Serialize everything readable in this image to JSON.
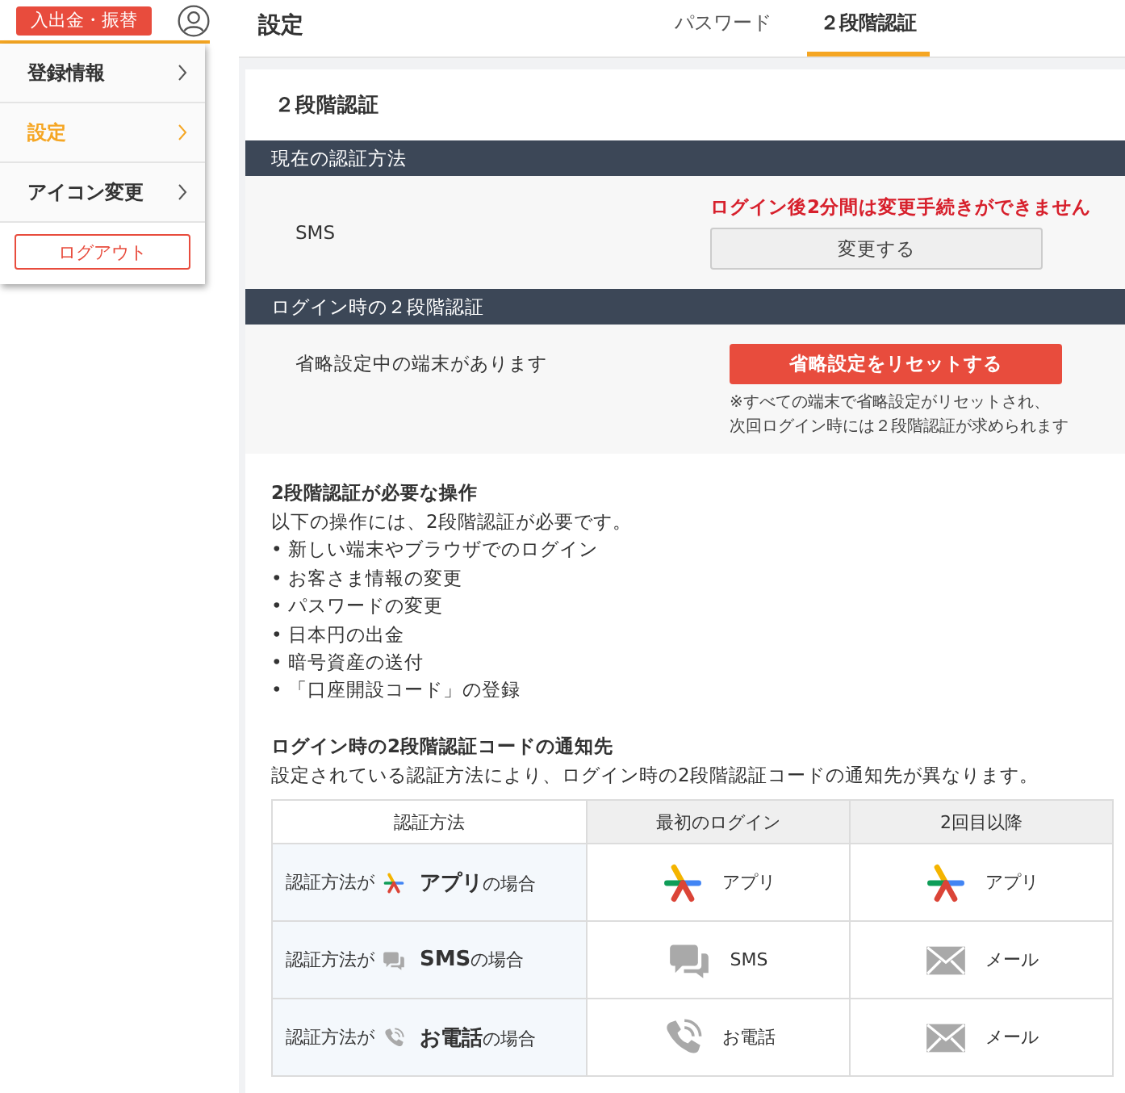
{
  "top_bar": {
    "deposit_button": "入出金・振替"
  },
  "user_menu": {
    "items": [
      {
        "label": "登録情報",
        "selected": false
      },
      {
        "label": "設定",
        "selected": true
      },
      {
        "label": "アイコン変更",
        "selected": false
      }
    ],
    "logout_button": "ログアウト"
  },
  "header": {
    "title": "設定",
    "tabs": [
      {
        "label": "パスワード",
        "selected": false
      },
      {
        "label": "２段階認証",
        "selected": true
      }
    ]
  },
  "card": {
    "title": "２段階認証",
    "current_method": {
      "heading": "現在の認証方法",
      "value": "SMS",
      "warning": "ログイン後2分間は変更手続きができません",
      "change_button": "変更する"
    },
    "login_2fa": {
      "heading": "ログイン時の２段階認証",
      "status": "省略設定中の端末があります",
      "reset_button": "省略設定をリセットする",
      "notes": [
        "※すべての端末で省略設定がリセットされ、",
        "次回ログイン時には２段階認証が求められます"
      ]
    },
    "required_operations": {
      "heading": "2段階認証が必要な操作",
      "intro": "以下の操作には、2段階認証が必要です。",
      "items": [
        "• 新しい端末やブラウザでのログイン",
        "• お客さま情報の変更",
        "• パスワードの変更",
        "• 日本円の出金",
        "• 暗号資産の送付",
        "• 「口座開設コード」の登録"
      ]
    },
    "notification": {
      "heading": "ログイン時の2段階認証コードの通知先",
      "intro": "設定されている認証方法により、ログイン時の2段階認証コードの通知先が異なります。",
      "table": {
        "columns": [
          "認証方法",
          "最初のログイン",
          "2回目以降"
        ],
        "rows": [
          {
            "method": {
              "prefix": "認証方法が",
              "kind": "app",
              "label": "**アプリ**の場合"
            },
            "first_login": {
              "kind": "app",
              "label": "アプリ"
            },
            "subsequent": {
              "kind": "app",
              "label": "アプリ"
            }
          },
          {
            "method": {
              "prefix": "認証方法が",
              "kind": "sms",
              "label": "**SMS**の場合"
            },
            "first_login": {
              "kind": "sms",
              "label": "SMS"
            },
            "subsequent": {
              "kind": "mail",
              "label": "メール"
            }
          },
          {
            "method": {
              "prefix": "認証方法が",
              "kind": "phone",
              "label": "**お電話**の場合"
            },
            "first_login": {
              "kind": "phone",
              "label": "お電話"
            },
            "subsequent": {
              "kind": "mail",
              "label": "メール"
            }
          }
        ]
      }
    }
  }
}
